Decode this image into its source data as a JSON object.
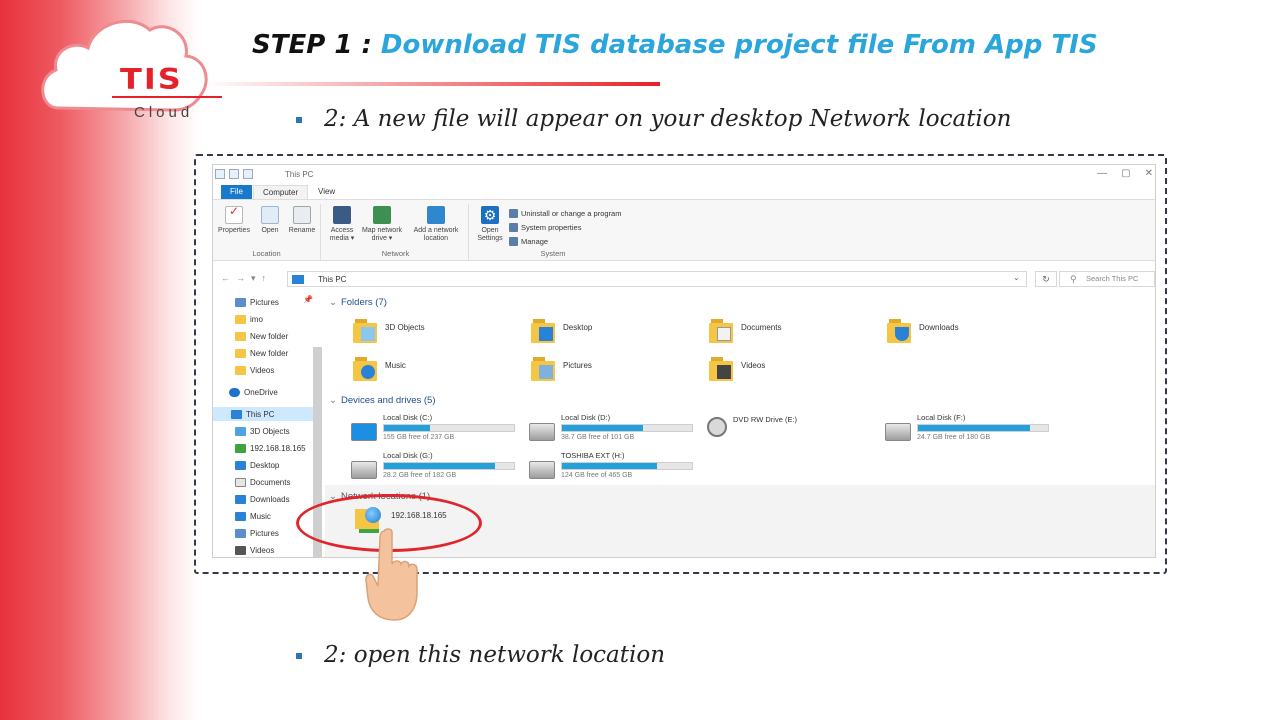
{
  "logo": {
    "brand": "TIS",
    "sub": "Cloud"
  },
  "slide": {
    "title_prefix": "STEP 1 : ",
    "title_main": "Download TIS database project file From App TIS",
    "bullet1": "2: A new file will appear on your desktop Network location",
    "bullet2": "2: open this network location"
  },
  "explorer": {
    "window_title": "This PC",
    "window_controls": [
      "—",
      "▢",
      "✕"
    ],
    "tabs": {
      "file": "File",
      "computer": "Computer",
      "view": "View"
    },
    "ribbon": {
      "location_group": "Location",
      "network_group": "Network",
      "system_group": "System",
      "properties": "Properties",
      "open": "Open",
      "rename": "Rename",
      "access_media": "Access media ▾",
      "map_network_drive": "Map network drive ▾",
      "add_network_location": "Add a network location",
      "open_settings": "Open Settings",
      "uninstall": "Uninstall or change a program",
      "system_properties": "System properties",
      "manage": "Manage"
    },
    "address": {
      "back": "←",
      "forward": "→",
      "recent": "▾",
      "up": "↑",
      "path": "This PC",
      "dropdown": "⌄",
      "refresh": "↻",
      "search_placeholder": "Search This PC",
      "search_icon": "⚲"
    },
    "nav": {
      "pin": "📌",
      "items": [
        "Pictures",
        "imo",
        "New folder",
        "New folder",
        "Videos",
        "OneDrive",
        "This PC",
        "3D Objects",
        "192.168.18.165",
        "Desktop",
        "Documents",
        "Downloads",
        "Music",
        "Pictures",
        "Videos"
      ]
    },
    "sections": {
      "chevron": "⌄",
      "folders": "Folders (7)",
      "devices": "Devices and drives (5)",
      "network": "Network locations (1)"
    },
    "folders": [
      "3D Objects",
      "Desktop",
      "Documents",
      "Downloads",
      "Music",
      "Pictures",
      "Videos"
    ],
    "drives": [
      {
        "name": "Local Disk (C:)",
        "free": "155 GB free of 237 GB",
        "used": 0.35
      },
      {
        "name": "Local Disk (D:)",
        "free": "38.7 GB free of 101 GB",
        "used": 0.62
      },
      {
        "name": "DVD RW Drive (E:)",
        "free": "",
        "used": 0
      },
      {
        "name": "Local Disk (F:)",
        "free": "24.7 GB free of 180 GB",
        "used": 0.86
      },
      {
        "name": "Local Disk (G:)",
        "free": "28.2 GB free of 182 GB",
        "used": 0.85
      },
      {
        "name": "TOSHIBA EXT (H:)",
        "free": "124 GB free of 465 GB",
        "used": 0.73
      }
    ],
    "network_item": "192.168.18.165"
  }
}
